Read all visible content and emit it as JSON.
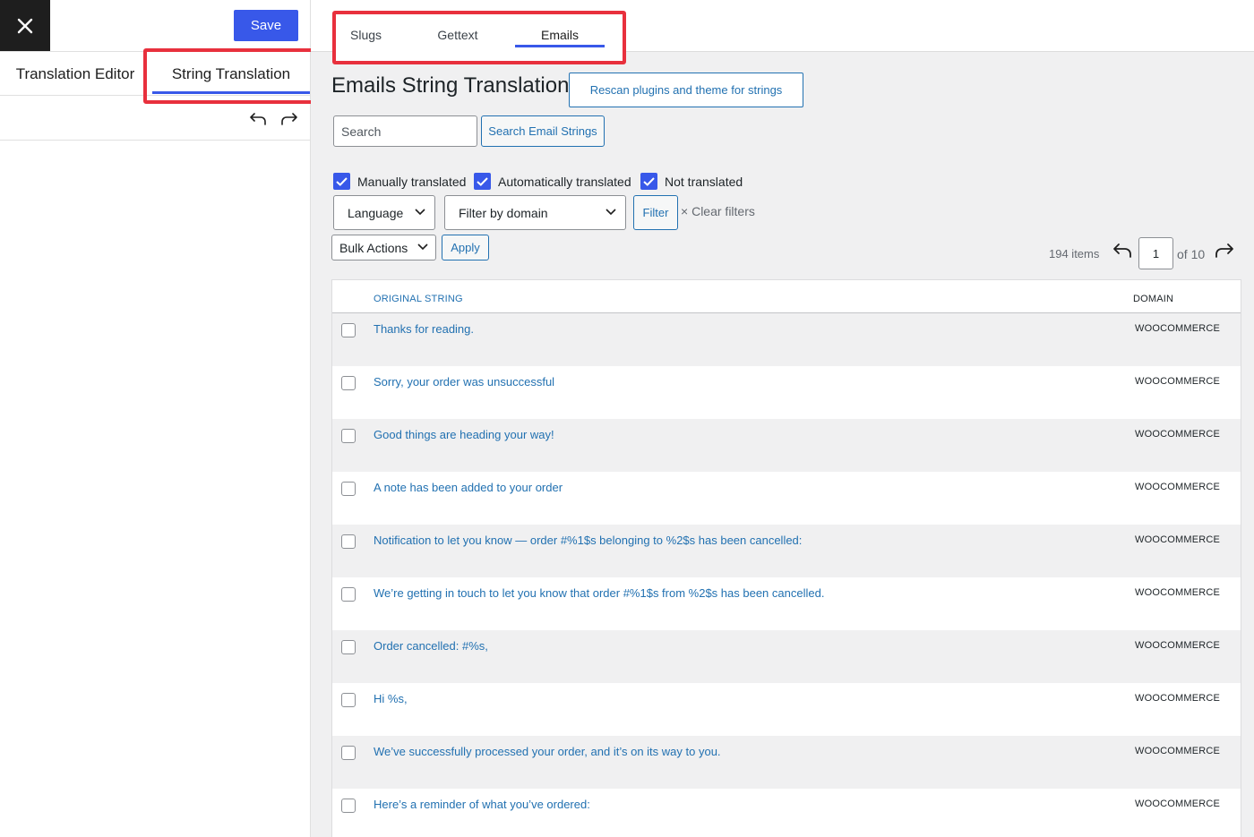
{
  "sidebar": {
    "save_label": "Save",
    "tabs": [
      {
        "label": "Translation Editor"
      },
      {
        "label": "String Translation"
      }
    ]
  },
  "main": {
    "tabs": [
      {
        "label": "Slugs"
      },
      {
        "label": "Gettext"
      },
      {
        "label": "Emails"
      }
    ],
    "active_tab": "Emails",
    "title": "Emails String Translation",
    "rescan_label": "Rescan plugins and theme for strings",
    "search": {
      "placeholder": "Search",
      "button_label": "Search Email Strings"
    },
    "checkboxes": [
      {
        "label": "Manually translated",
        "checked": true
      },
      {
        "label": "Automatically translated",
        "checked": true
      },
      {
        "label": "Not translated",
        "checked": true
      }
    ],
    "language_select": "Language",
    "domain_select": "Filter by domain",
    "filter_label": "Filter",
    "clear_filters_label": "Clear filters",
    "bulk_actions": "Bulk Actions",
    "apply_label": "Apply",
    "pagination": {
      "items": "194 items",
      "current_page": "1",
      "of_label": "of 10"
    },
    "table": {
      "columns": [
        "Original String",
        "Domain"
      ],
      "rows": [
        {
          "text": "Thanks for reading.",
          "domain": "WOOCOMMERCE"
        },
        {
          "text": "Sorry, your order was unsuccessful",
          "domain": "WOOCOMMERCE"
        },
        {
          "text": "Good things are heading your way!",
          "domain": "WOOCOMMERCE"
        },
        {
          "text": "A note has been added to your order",
          "domain": "WOOCOMMERCE"
        },
        {
          "text": "Notification to let you know — order #%1$s belonging to %2$s has been cancelled:",
          "domain": "WOOCOMMERCE"
        },
        {
          "text": "We’re getting in touch to let you know that order #%1$s from %2$s has been cancelled.",
          "domain": "WOOCOMMERCE"
        },
        {
          "text": "Order cancelled: #%s,",
          "domain": "WOOCOMMERCE"
        },
        {
          "text": "Hi %s,",
          "domain": "WOOCOMMERCE"
        },
        {
          "text": "We’ve successfully processed your order, and it’s on its way to you.",
          "domain": "WOOCOMMERCE"
        },
        {
          "text": "Here’s a reminder of what you’ve ordered:",
          "domain": "WOOCOMMERCE"
        }
      ]
    }
  },
  "colors": {
    "accent": "#3858e9",
    "link": "#2271b1",
    "highlight": "#e8303d"
  }
}
